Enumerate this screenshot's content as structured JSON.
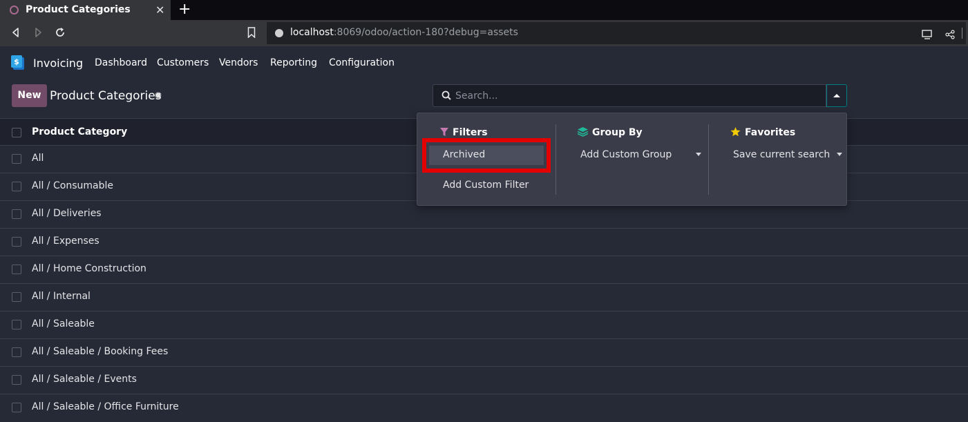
{
  "browser": {
    "tab_title": "Product Categories",
    "url_host": "localhost",
    "url_rest": ":8069/odoo/action-180?debug=assets"
  },
  "navbar": {
    "app_name": "Invoicing",
    "menu": [
      "Dashboard",
      "Customers",
      "Vendors",
      "Reporting",
      "Configuration"
    ]
  },
  "control_panel": {
    "new_label": "New",
    "title": "Product Categories",
    "search_placeholder": "Search..."
  },
  "list": {
    "column": "Product Category",
    "rows": [
      "All",
      "All / Consumable",
      "All / Deliveries",
      "All / Expenses",
      "All / Home Construction",
      "All / Internal",
      "All / Saleable",
      "All / Saleable / Booking Fees",
      "All / Saleable / Events",
      "All / Saleable / Office Furniture"
    ]
  },
  "dropdown": {
    "filters": {
      "heading": "Filters",
      "items": [
        "Archived",
        "Add Custom Filter"
      ]
    },
    "group_by": {
      "heading": "Group By",
      "item": "Add Custom Group"
    },
    "favorites": {
      "heading": "Favorites",
      "item": "Save current search"
    }
  },
  "colors": {
    "accent": "#714b67",
    "teal": "#017e84",
    "highlight": "#e30000"
  }
}
